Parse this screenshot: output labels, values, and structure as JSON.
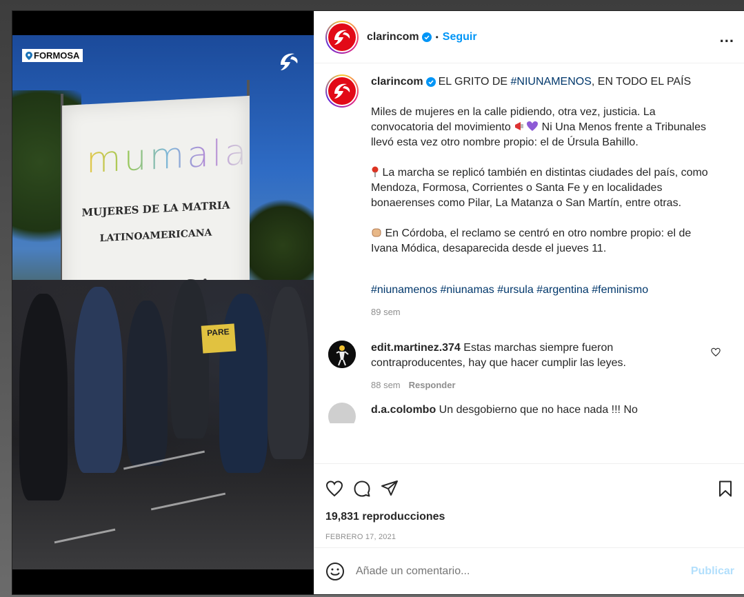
{
  "media": {
    "location_tag": "FORMOSA",
    "banner": {
      "word": "mumala",
      "line1": "MUJERES DE LA MATRIA",
      "line2": "LATINOAMERICANA",
      "line3": "FORMOSA"
    },
    "sign_text": "PARE"
  },
  "header": {
    "username": "clarincom",
    "separator": "•",
    "follow_label": "Seguir",
    "more_label": "..."
  },
  "caption": {
    "username": "clarincom",
    "title_prefix": "EL GRITO DE ",
    "title_hashtag": "#NIUNAMENOS",
    "title_suffix": ", EN TODO EL PAÍS",
    "p1a": "Miles de mujeres en la calle pidiendo, otra vez, justicia. La convocatoria del movimiento ",
    "p1b": " Ni Una Menos frente a Tribunales llevó esta vez otro nombre propio: el de Úrsula Bahillo.",
    "p2": " La marcha se replicó también en distintas ciudades del país, como Mendoza, Formosa, Corrientes o Santa Fe y en localidades bonaerenses como Pilar, La Matanza o San Martín, entre otras.",
    "p3": " En Córdoba, el reclamo se centró en otro nombre propio: el de Ivana Módica, desaparecida desde el jueves 11.",
    "hashtags": [
      "#niunamenos",
      "#niunamas",
      "#ursula",
      "#argentina",
      "#feminismo"
    ],
    "time_ago": "89 sem"
  },
  "comments": [
    {
      "username": "edit.martinez.374",
      "text": " Estas marchas siempre fueron contraproducentes, hay que hacer cumplir las leyes.",
      "time_ago": "88 sem",
      "reply_label": "Responder"
    },
    {
      "username": "d.a.colombo",
      "text": " Un desgobierno que no hace nada !!! No"
    }
  ],
  "actions": {
    "views": "19,831 reproducciones",
    "date": "FEBRERO 17, 2021"
  },
  "add_comment": {
    "placeholder": "Añade un comentario...",
    "publish_label": "Publicar"
  },
  "colors": {
    "brand_red": "#e20a17",
    "link_blue": "#0095f6",
    "hashtag_blue": "#00376b",
    "muted": "#8e8e8e"
  }
}
